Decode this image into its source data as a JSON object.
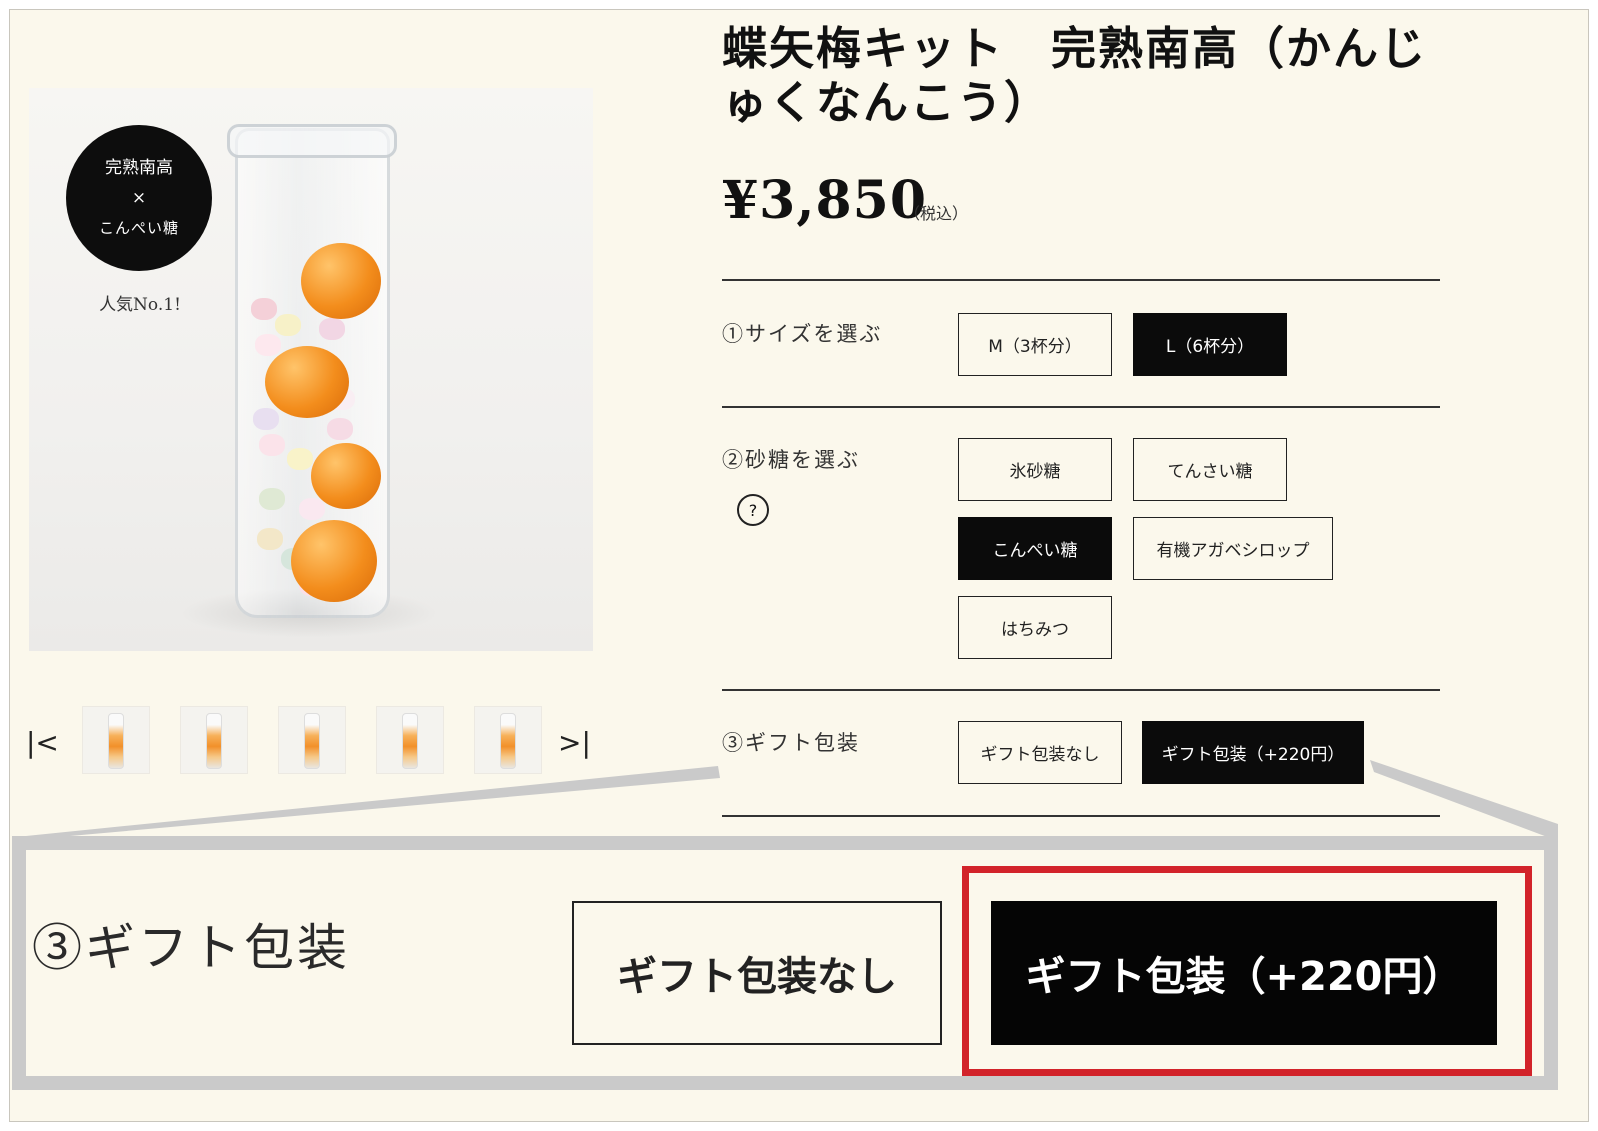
{
  "product": {
    "title": "蝶矢梅キット　完熟南高（かんじゅくなんこう）",
    "price": "¥3,850",
    "tax_note": "（税込）"
  },
  "badge": {
    "line1": "完熟南高",
    "line2": "×",
    "line3": "こんぺい糖",
    "caption": "人気No.1!"
  },
  "thumbnails": {
    "first_icon": "|<",
    "last_icon": ">|",
    "count": 5
  },
  "options": {
    "size": {
      "label": "①サイズを選ぶ",
      "choices": [
        {
          "label": "M（3杯分）",
          "selected": false
        },
        {
          "label": "L（6杯分）",
          "selected": true
        }
      ]
    },
    "sugar": {
      "label": "②砂糖を選ぶ",
      "help_icon": "?",
      "choices": [
        {
          "label": "氷砂糖",
          "selected": false
        },
        {
          "label": "てんさい糖",
          "selected": false
        },
        {
          "label": "こんぺい糖",
          "selected": true
        },
        {
          "label": "有機アガベシロップ",
          "selected": false
        },
        {
          "label": "はちみつ",
          "selected": false
        }
      ]
    },
    "gift": {
      "label": "③ギフト包装",
      "choices": [
        {
          "label": "ギフト包装なし",
          "selected": false
        },
        {
          "label": "ギフト包装（+220円）",
          "selected": true
        }
      ]
    }
  },
  "zoom": {
    "label": "③ギフト包装",
    "plain_button": "ギフト包装なし",
    "dark_button": "ギフト包装（+220円）",
    "highlight_color": "#d2232a"
  },
  "colors": {
    "background": "#fbf8ec",
    "selected": "#0b0b0b",
    "callout_border": "#cacaca"
  }
}
